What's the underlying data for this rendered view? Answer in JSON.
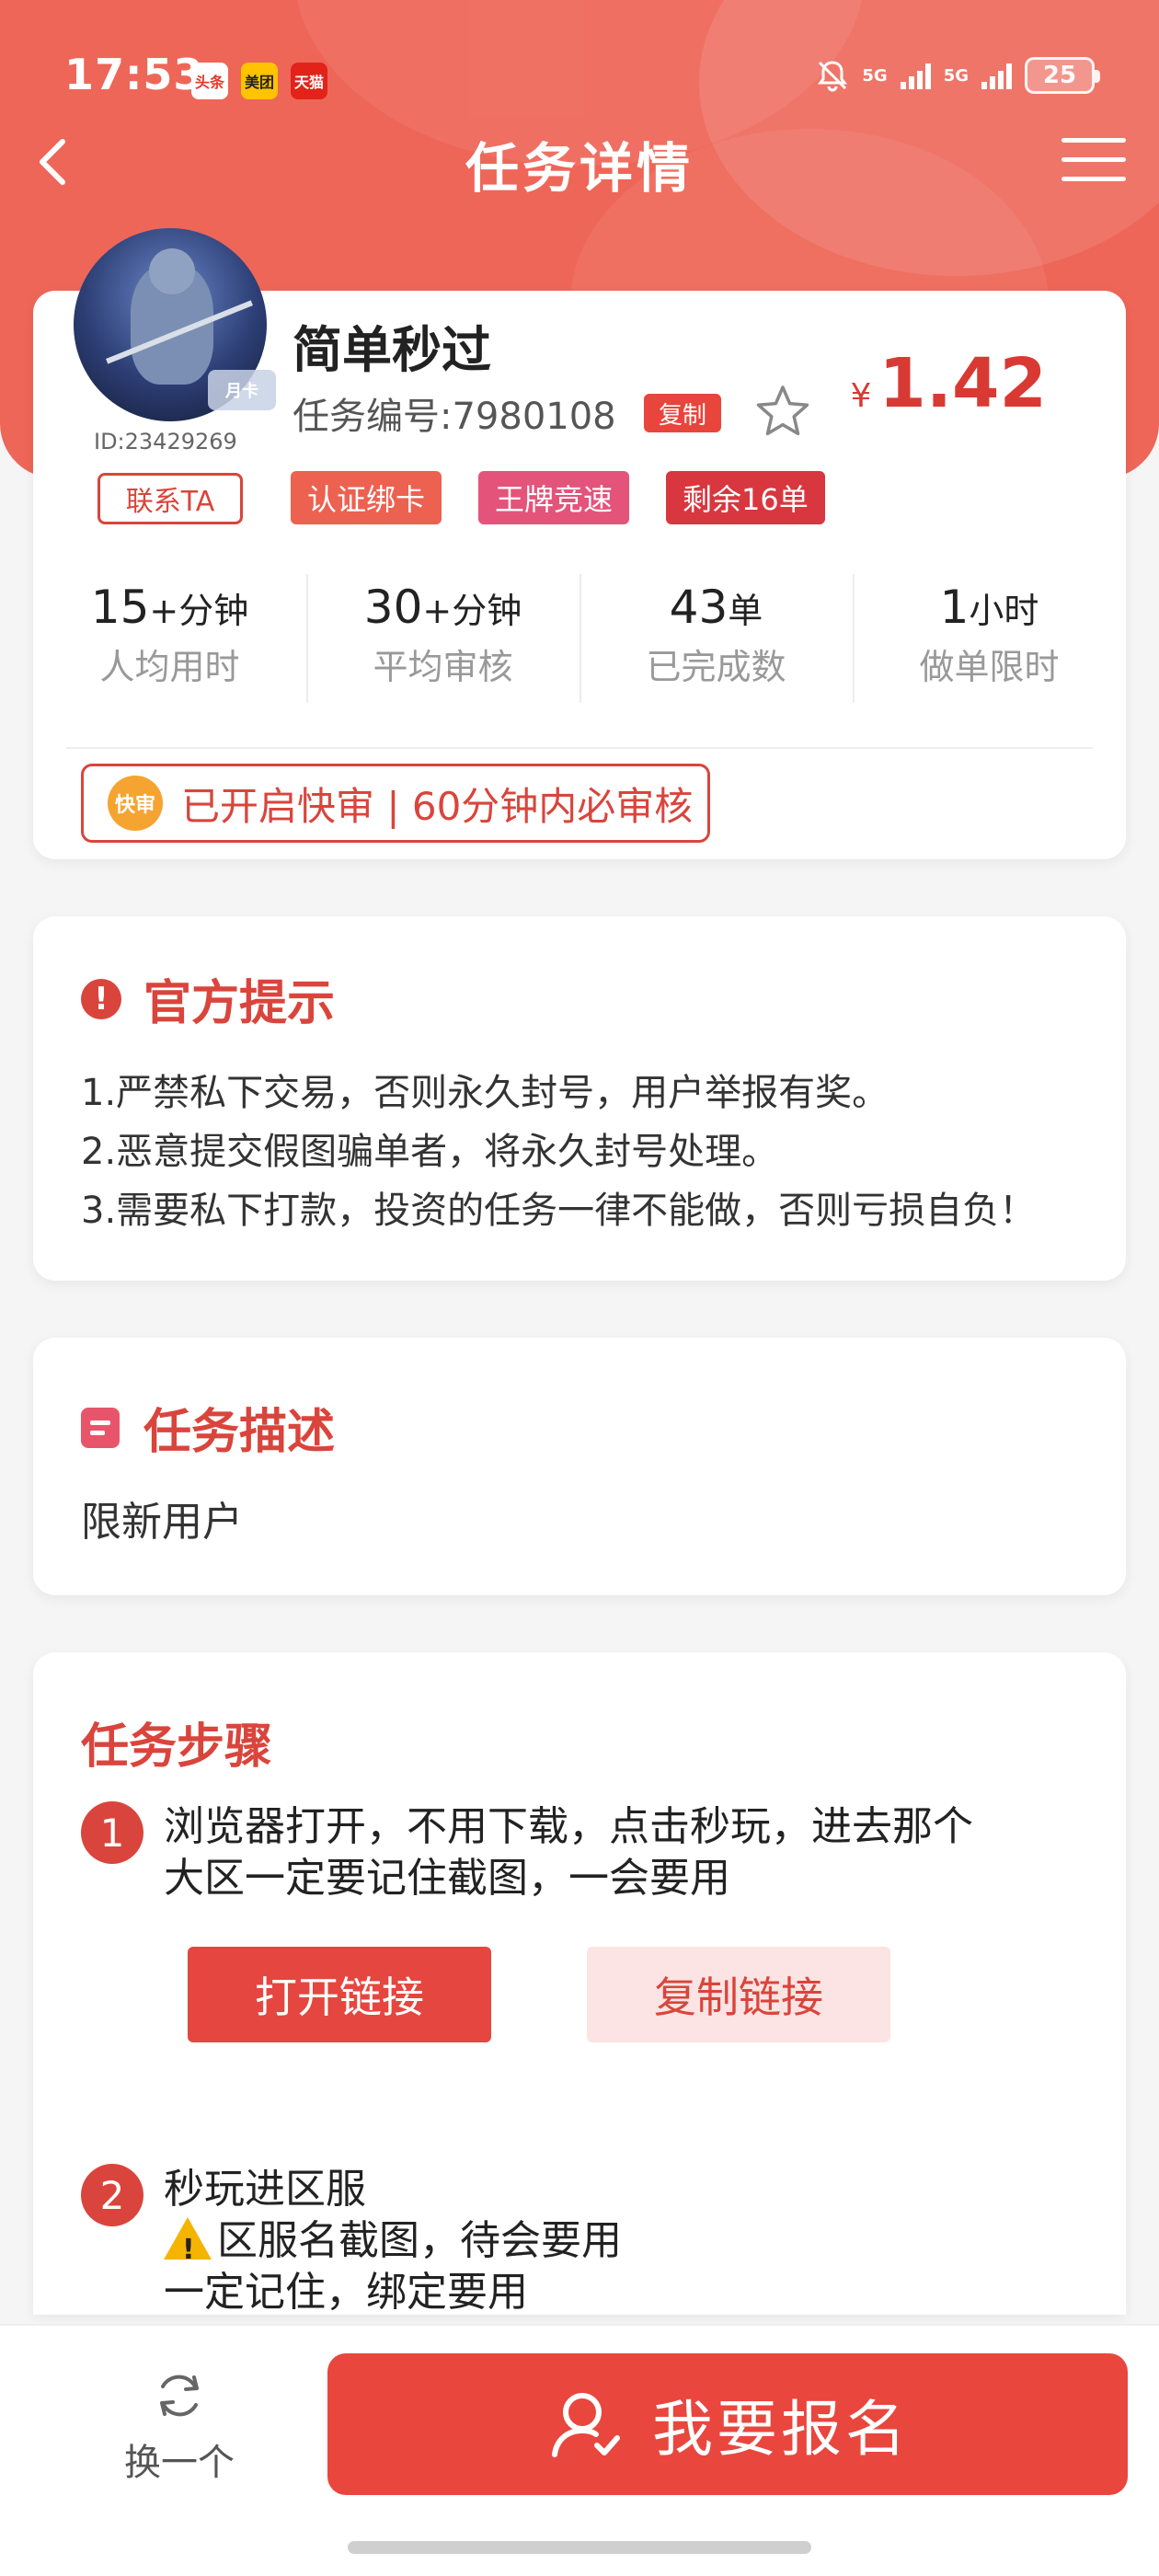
{
  "status_bar": {
    "time": "17:53",
    "apps": [
      "头条",
      "美团",
      "天猫"
    ],
    "network1": "5G",
    "network2": "5G",
    "battery": "25"
  },
  "nav": {
    "title": "任务详情"
  },
  "task": {
    "avatar_badge": "月卡",
    "user_id": "ID:23429269",
    "title": "简单秒过",
    "number": "任务编号:7980108",
    "copy_label": "复制",
    "price_symbol": "¥",
    "price": "1.42",
    "contact_label": "联系TA",
    "tags": [
      "认证绑卡",
      "王牌竞速",
      "剩余16单"
    ],
    "stats": [
      {
        "value": "15",
        "unit": "+分钟",
        "label": "人均用时"
      },
      {
        "value": "30",
        "unit": "+分钟",
        "label": "平均审核"
      },
      {
        "value": "43",
        "unit": "单",
        "label": "已完成数"
      },
      {
        "value": "1",
        "unit": "小时",
        "label": "做单限时"
      }
    ],
    "fast_review_badge": "快审",
    "fast_review_text": "已开启快审 | 60分钟内必审核"
  },
  "notice": {
    "title": "官方提示",
    "lines": [
      "1.严禁私下交易，否则永久封号，用户举报有奖。",
      "2.恶意提交假图骗单者，将永久封号处理。",
      "3.需要私下打款，投资的任务一律不能做，否则亏损自负！"
    ]
  },
  "description": {
    "title": "任务描述",
    "text": "限新用户"
  },
  "steps": {
    "title": "任务步骤",
    "items": [
      {
        "num": "1",
        "lines": [
          "浏览器打开，不用下载，点击秒玩，进去那个",
          "大区一定要记住截图，一会要用"
        ]
      },
      {
        "num": "2",
        "lines": [
          "秒玩进区服",
          "区服名截图，待会要用",
          "一定记住，绑定要用"
        ]
      }
    ],
    "open_link": "打开链接",
    "copy_link": "复制链接"
  },
  "bottom": {
    "swap_label": "换一个",
    "signup_label": "我要报名"
  },
  "colors": {
    "header": "#ee6658",
    "accent": "#d9453c",
    "button": "#e9463e"
  }
}
